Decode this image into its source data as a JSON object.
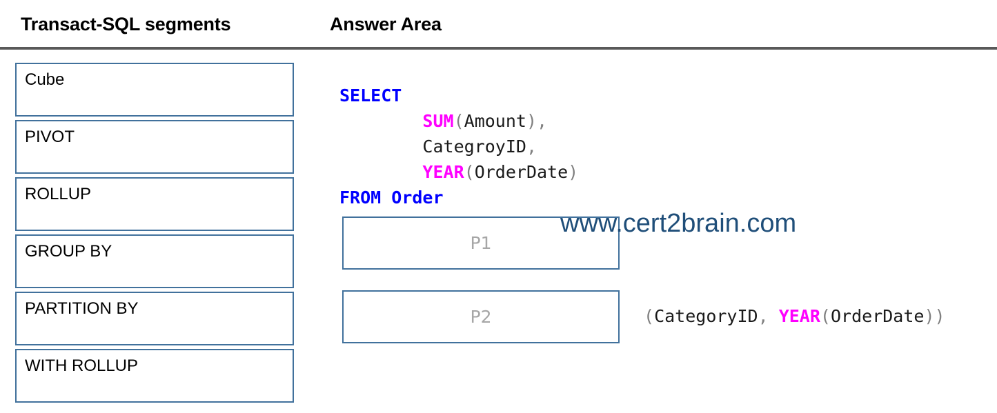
{
  "header": {
    "segments_title": "Transact-SQL segments",
    "answer_title": "Answer Area"
  },
  "segments": {
    "items": [
      {
        "label": "Cube"
      },
      {
        "label": "PIVOT"
      },
      {
        "label": "ROLLUP"
      },
      {
        "label": "GROUP BY"
      },
      {
        "label": "PARTITION BY"
      },
      {
        "label": "WITH ROLLUP"
      }
    ]
  },
  "answer_area": {
    "code": {
      "line1_keyword": "SELECT",
      "line2_function": "SUM",
      "line2_open": "(",
      "line2_identifier": "Amount",
      "line2_close": ")",
      "line2_comma": ",",
      "line3_identifier": "CategroyID",
      "line3_comma": ",",
      "line4_function": "YEAR",
      "line4_open": "(",
      "line4_identifier": "OrderDate",
      "line4_close": ")",
      "line5_keyword": "FROM",
      "line5_identifier": "Order"
    },
    "drop_zones": [
      {
        "placeholder": "P1"
      },
      {
        "placeholder": "P2"
      }
    ],
    "group_expression": {
      "open_paren": "(",
      "identifier": "CategoryID",
      "comma": ",",
      "function": "YEAR",
      "inner_open": "(",
      "inner_identifier": "OrderDate",
      "inner_close": ")",
      "close_paren": ")"
    }
  },
  "watermark": {
    "text": "www.cert2brain.com"
  },
  "colors": {
    "box_border": "#41719c",
    "keyword": "#0000ff",
    "function": "#ff00ff",
    "punctuation": "#808080",
    "identifier": "#1a1a1a",
    "placeholder": "#a6a6a6",
    "divider": "#595959",
    "watermark": "#1f4e79"
  }
}
